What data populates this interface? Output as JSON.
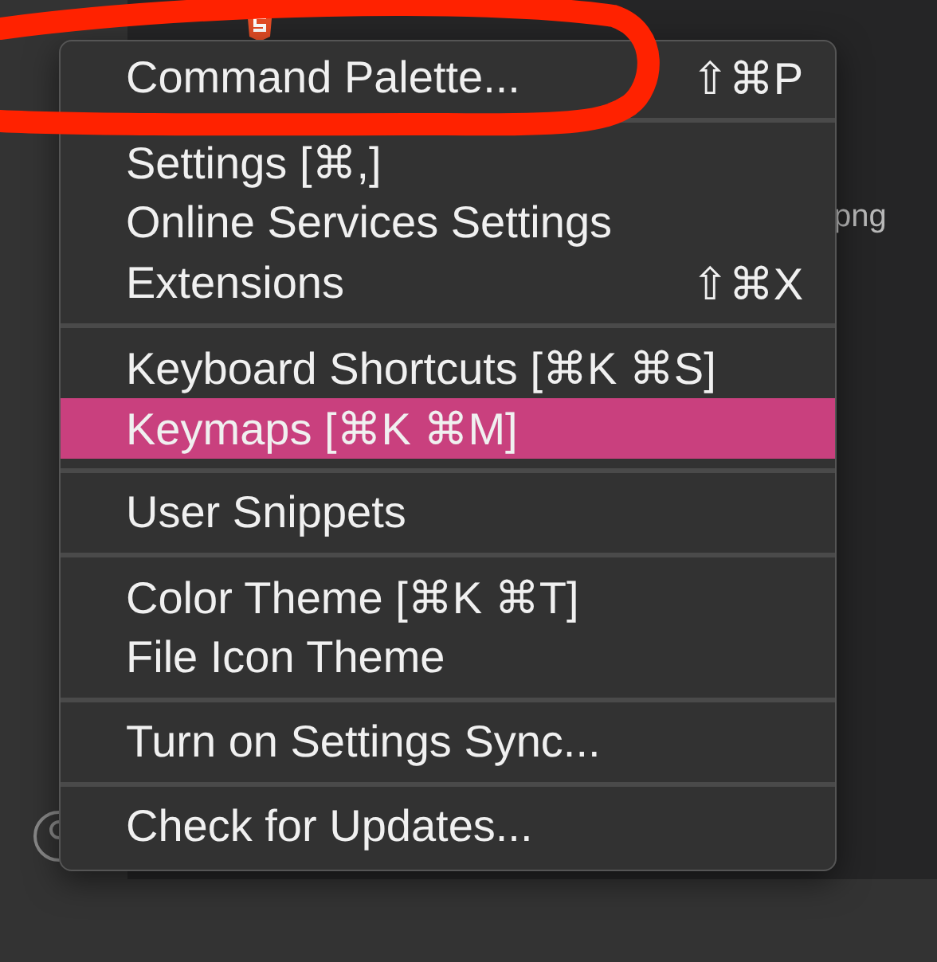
{
  "explorer": {
    "file_suffix": "png"
  },
  "menu": {
    "groups": [
      {
        "items": [
          {
            "label": "Command Palette...",
            "shortcut": "⇧⌘P",
            "selected": false
          }
        ]
      },
      {
        "items": [
          {
            "label": "Settings [⌘,]",
            "selected": false
          },
          {
            "label": "Online Services Settings",
            "selected": false
          },
          {
            "label": "Extensions",
            "shortcut": "⇧⌘X",
            "selected": false
          }
        ]
      },
      {
        "items": [
          {
            "label": "Keyboard Shortcuts [⌘K ⌘S]",
            "selected": false
          },
          {
            "label": "Keymaps [⌘K ⌘M]",
            "selected": true
          }
        ]
      },
      {
        "items": [
          {
            "label": "User Snippets",
            "selected": false
          }
        ]
      },
      {
        "items": [
          {
            "label": "Color Theme [⌘K ⌘T]",
            "selected": false
          },
          {
            "label": "File Icon Theme",
            "selected": false
          }
        ]
      },
      {
        "items": [
          {
            "label": "Turn on Settings Sync...",
            "selected": false
          }
        ]
      },
      {
        "items": [
          {
            "label": "Check for Updates...",
            "selected": false
          }
        ]
      }
    ]
  }
}
